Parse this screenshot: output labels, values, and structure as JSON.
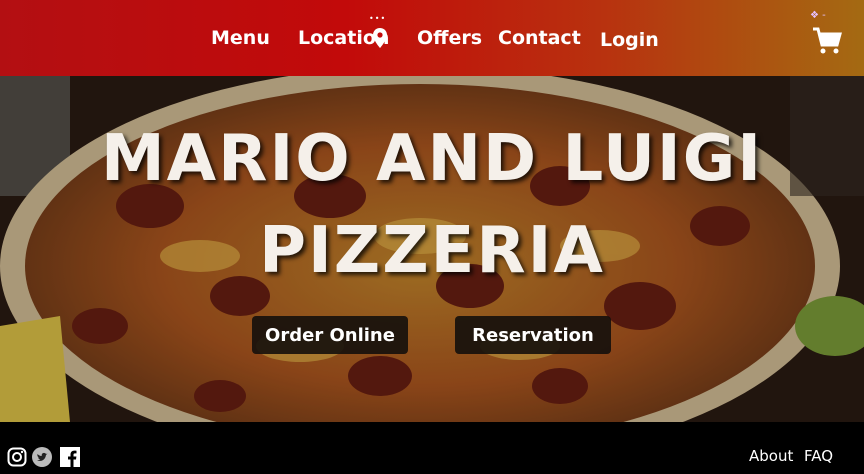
{
  "nav": {
    "menu": "Menu",
    "location": "Location",
    "offers": "Offers",
    "contact": "Contact",
    "login": "Login",
    "icons": [
      "location-pin-icon",
      "cart-icon"
    ]
  },
  "hero": {
    "title_line1": "MARIO AND LUIGI",
    "title_line2": "PIZZERIA",
    "order_button": "Order Online",
    "reservation_button": "Reservation"
  },
  "footer": {
    "about": "About",
    "faq": "FAQ",
    "social_icons": [
      "instagram-icon",
      "twitter-icon",
      "facebook-icon"
    ]
  },
  "colors": {
    "nav_start": "#c20a0a",
    "nav_end": "#a46a12",
    "footer": "#000000"
  }
}
